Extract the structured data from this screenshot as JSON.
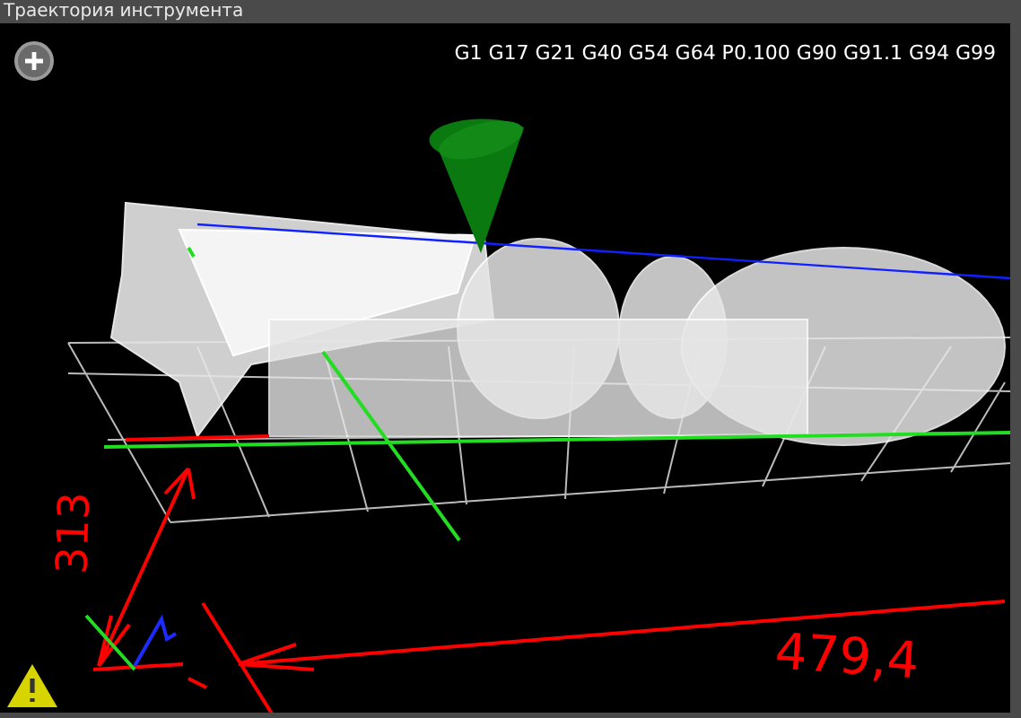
{
  "window": {
    "title": "Траектория инструмента"
  },
  "viewport": {
    "modal_codes": "G1 G17 G21 G40 G54 G64 P0.100 G90 G91.1 G94 G99",
    "warning": true
  },
  "annotations": [
    {
      "kind": "vertical",
      "text": "313"
    },
    {
      "kind": "horizontal",
      "text": "479,4"
    }
  ]
}
